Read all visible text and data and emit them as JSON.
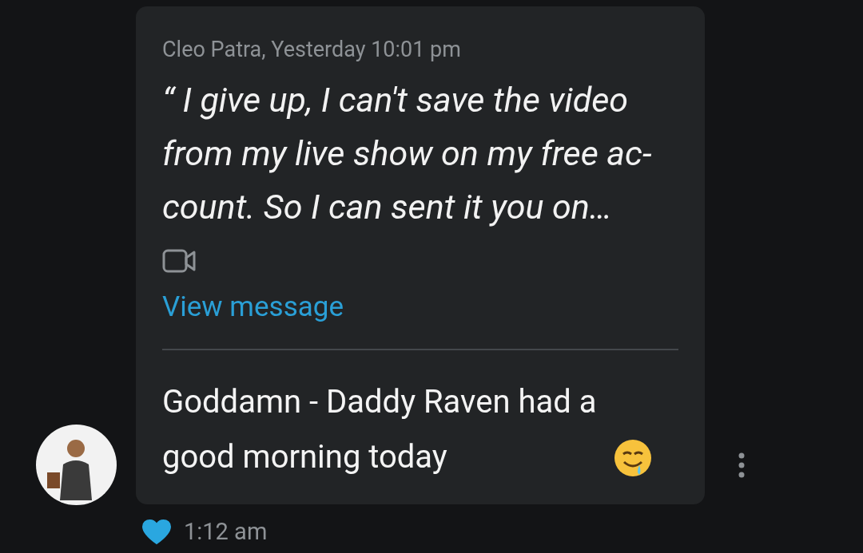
{
  "message": {
    "quote": {
      "meta": "Cleo Patra, Yesterday 10:01 pm",
      "text": "“ I give up, I can't save the video from my live show on my free ac-count. So I can sent it you on…",
      "video_attachment": true,
      "link": "View message"
    },
    "text": "Goddamn - Daddy Raven had a good morning today",
    "liked": true,
    "time": "1:12 am"
  }
}
